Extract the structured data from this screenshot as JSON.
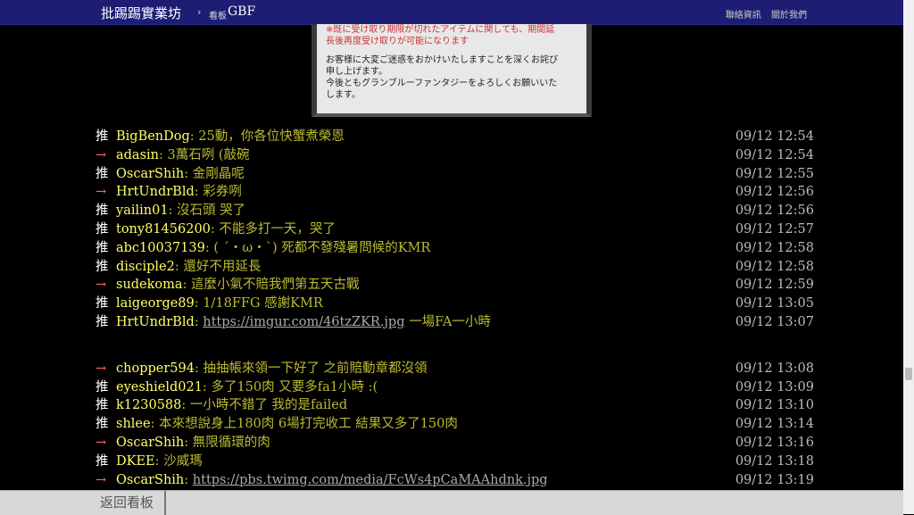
{
  "header": {
    "site_title": "批踢踢實業坊",
    "separator": "›",
    "board_label": "看板",
    "board_name": "GBF",
    "links": [
      "聯絡資訊",
      "關於我們"
    ]
  },
  "image_notice": {
    "line1": "※既に受け取り期限が切れたアイテムに関しても、期間延",
    "line2": "長後再度受け取りが可能になります",
    "line3": "お客様に大変ご迷惑をおかけいたしますことを深くお詫び",
    "line4": "申し上げます。",
    "line5": "今後ともグランブルーファンタジーをよろしくお願いいた",
    "line6": "します。"
  },
  "pushes_a": [
    {
      "tag": "推",
      "user": "BigBenDog",
      "content": ": 25動，你各位快蟹煮榮恩",
      "time": "09/12 12:54"
    },
    {
      "tag": "→",
      "user": "adasin",
      "content": ": 3萬石咧 (敲碗",
      "time": "09/12 12:54"
    },
    {
      "tag": "推",
      "user": "OscarShih",
      "content": ": 金剛晶呢",
      "time": "09/12 12:55"
    },
    {
      "tag": "→",
      "user": "HrtUndrBld",
      "content": ": 彩券咧",
      "time": "09/12 12:56"
    },
    {
      "tag": "推",
      "user": "yailin01",
      "content": ": 沒石頭 哭了",
      "time": "09/12 12:56"
    },
    {
      "tag": "推",
      "user": "tony81456200",
      "content": ": 不能多打一天，哭了",
      "time": "09/12 12:57"
    },
    {
      "tag": "推",
      "user": "abc10037139",
      "content": ": ( ˊ・ω・ˋ) 死都不發殘暑問候的KMR",
      "time": "09/12 12:58"
    },
    {
      "tag": "推",
      "user": "disciple2",
      "content": ": 還好不用延長",
      "time": "09/12 12:58"
    },
    {
      "tag": "→",
      "user": "sudekoma",
      "content": ": 這麼小氣不賠我們第五天古戰",
      "time": "09/12 12:59"
    },
    {
      "tag": "推",
      "user": "laigeorge89",
      "content": ": 1/18FFG 感謝KMR",
      "time": "09/12 13:05"
    },
    {
      "tag": "推",
      "user": "HrtUndrBld",
      "content": ": ",
      "link": "https://imgur.com/46tzZKR.jpg",
      "after": " 一場FA一小時",
      "time": "09/12 13:07"
    }
  ],
  "pushes_b": [
    {
      "tag": "→",
      "user": "chopper594",
      "content": ": 抽抽帳來領一下好了  之前賠動章都沒領",
      "time": "09/12 13:08"
    },
    {
      "tag": "推",
      "user": "eyeshield021",
      "content": ": 多了150肉 又要多fa1小時 :(",
      "time": "09/12 13:09"
    },
    {
      "tag": "推",
      "user": "k1230588",
      "content": ": 一小時不錯了 我的是failed",
      "time": "09/12 13:10"
    },
    {
      "tag": "推",
      "user": "shlee",
      "content": ": 本來想說身上180肉 6場打完收工 結果又多了150肉",
      "time": "09/12 13:14"
    },
    {
      "tag": "→",
      "user": "OscarShih",
      "content": ": 無限循環的肉",
      "time": "09/12 13:16"
    },
    {
      "tag": "推",
      "user": "DKEE",
      "content": ": 沙威瑪",
      "time": "09/12 13:18"
    },
    {
      "tag": "→",
      "user": "OscarShih",
      "content": ": ",
      "link": "https://pbs.twimg.com/media/FcWs4pCaMAAhdnk.jpg",
      "after": "",
      "time": "09/12 13:19"
    }
  ],
  "footer": {
    "back_label": "返回看板"
  }
}
